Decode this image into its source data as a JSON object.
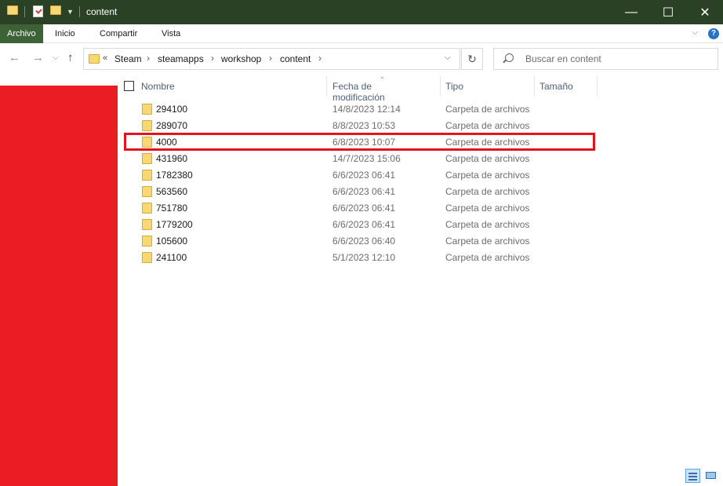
{
  "window": {
    "title": "content",
    "minimize": "—",
    "maximize": "☐",
    "close": "✕"
  },
  "ribbon": {
    "tabs": [
      {
        "label": "Archivo",
        "active": true
      },
      {
        "label": "Inicio"
      },
      {
        "label": "Compartir"
      },
      {
        "label": "Vista"
      }
    ],
    "help": "?"
  },
  "nav": {
    "breadcrumbs": [
      "Steam",
      "steamapps",
      "workshop",
      "content"
    ],
    "search_placeholder": "Buscar en content"
  },
  "columns": {
    "name": "Nombre",
    "date": "Fecha de modificación",
    "type": "Tipo",
    "size": "Tamaño"
  },
  "files": [
    {
      "name": "294100",
      "date": "14/8/2023 12:14",
      "type": "Carpeta de archivos"
    },
    {
      "name": "289070",
      "date": "8/8/2023 10:53",
      "type": "Carpeta de archivos"
    },
    {
      "name": "4000",
      "date": "6/8/2023 10:07",
      "type": "Carpeta de archivos",
      "highlighted": true
    },
    {
      "name": "431960",
      "date": "14/7/2023 15:06",
      "type": "Carpeta de archivos"
    },
    {
      "name": "1782380",
      "date": "6/6/2023 06:41",
      "type": "Carpeta de archivos"
    },
    {
      "name": "563560",
      "date": "6/6/2023 06:41",
      "type": "Carpeta de archivos"
    },
    {
      "name": "751780",
      "date": "6/6/2023 06:41",
      "type": "Carpeta de archivos"
    },
    {
      "name": "1779200",
      "date": "6/6/2023 06:41",
      "type": "Carpeta de archivos"
    },
    {
      "name": "105600",
      "date": "6/6/2023 06:40",
      "type": "Carpeta de archivos"
    },
    {
      "name": "241100",
      "date": "5/1/2023 12:10",
      "type": "Carpeta de archivos"
    }
  ],
  "colors": {
    "titlebar": "#2b4125",
    "active_tab": "#3c6236",
    "nav_pane": "#ec1c24",
    "highlight_border": "#e0151d"
  }
}
